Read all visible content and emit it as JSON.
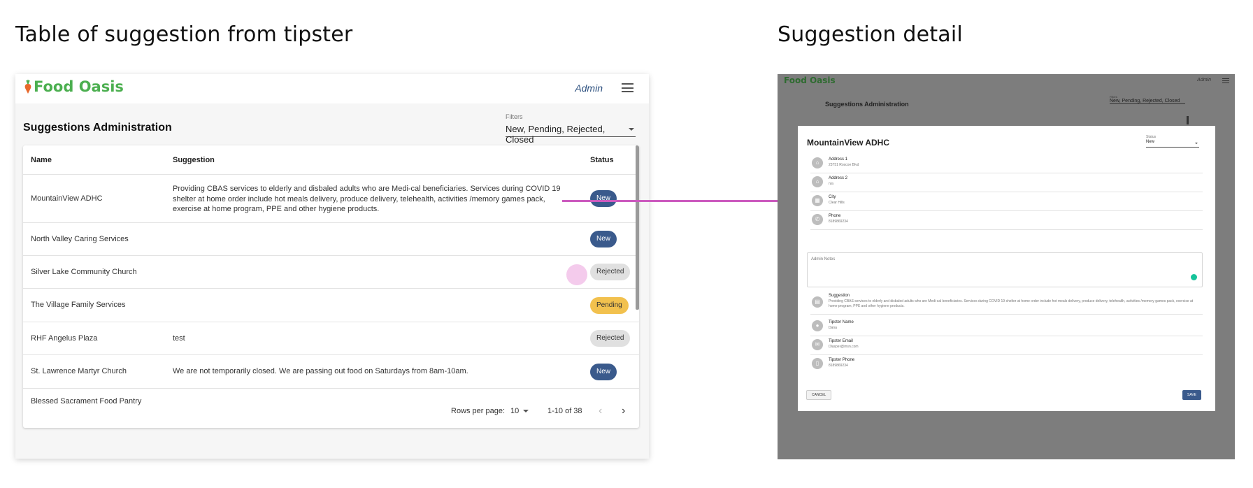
{
  "headings": {
    "left": "Table of suggestion from tipster",
    "right": "Suggestion detail"
  },
  "app": {
    "logo_text": "Food Oasis",
    "admin_link": "Admin",
    "brand_color": "#4caf50",
    "accent_color": "#3a5a8c"
  },
  "list_page": {
    "title": "Suggestions Administration",
    "filters_label": "Filters",
    "filters_value": "New, Pending, Rejected, Closed",
    "columns": [
      "Name",
      "Suggestion",
      "Status"
    ],
    "rows": [
      {
        "name": "MountainView ADHC",
        "suggestion": "Providing CBAS services to elderly and disbaled adults who are Medi-cal beneficiaries. Services during COVID 19 shelter at home order include hot meals delivery, produce delivery, telehealth, activities /memory games pack, exercise at home program, PPE and other hygiene products.",
        "status": "New"
      },
      {
        "name": "North Valley Caring Services",
        "suggestion": "",
        "status": "New"
      },
      {
        "name": "Silver Lake Community Church",
        "suggestion": "",
        "status": "Rejected"
      },
      {
        "name": "The Village Family Services",
        "suggestion": "",
        "status": "Pending"
      },
      {
        "name": "RHF Angelus Plaza",
        "suggestion": "test",
        "status": "Rejected"
      },
      {
        "name": "St. Lawrence Martyr Church",
        "suggestion": "We are not temporarily closed. We are passing out food on Saturdays from 8am-10am.",
        "status": "New"
      },
      {
        "name": "Blessed Sacrament Food Pantry",
        "suggestion": "",
        "status": ""
      }
    ],
    "pagination": {
      "rows_per_page_label": "Rows per page:",
      "rows_per_page_value": "10",
      "range": "1-10 of 38"
    }
  },
  "detail_page": {
    "bg_title": "Suggestions Administration",
    "bg_filters_label": "Filters",
    "bg_filters_value": "New, Pending, Rejected, Closed",
    "modal_title": "MountainView ADHC",
    "status_label": "Status",
    "status_value": "New",
    "fields": [
      {
        "icon": "home-icon",
        "label": "Address 1",
        "value": "23751 Roscoe Blvd"
      },
      {
        "icon": "home-icon",
        "label": "Address 2",
        "value": "n/a"
      },
      {
        "icon": "city-icon",
        "label": "City",
        "value": "Clear Hills"
      },
      {
        "icon": "phone-icon",
        "label": "Phone",
        "value": "8189869234"
      }
    ],
    "admin_notes_label": "Admin Notes",
    "suggestion_label": "Suggestion",
    "suggestion_value": "Providing CBAS services to elderly and disbaled adults who are Medi-cal beneficiaries. Services during COVID 19 shelter at home order include hot meals delivery, produce delivery, telehealth, activities /memory games pack, exercise at home program, PPE and other hygiene products.",
    "tipster_fields": [
      {
        "icon": "person-icon",
        "label": "Tipster Name",
        "value": "Dana"
      },
      {
        "icon": "mail-icon",
        "label": "Tipster Email",
        "value": "Dlasper@msn.com"
      },
      {
        "icon": "mobile-icon",
        "label": "Tipster Phone",
        "value": "8189869234"
      }
    ],
    "cancel_label": "CANCEL",
    "save_label": "SAVE"
  }
}
